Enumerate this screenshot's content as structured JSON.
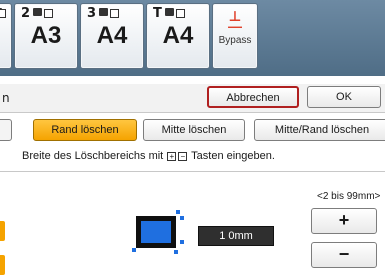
{
  "trays": [
    {
      "number": "",
      "size": "",
      "partial": true
    },
    {
      "number": "2",
      "size": "A3"
    },
    {
      "number": "3",
      "size": "A4"
    },
    {
      "number": "T",
      "size": "A4"
    }
  ],
  "bypass": {
    "icon": "bypass-tray-icon",
    "label": "Bypass"
  },
  "header": {
    "left_fragment": "n",
    "cancel_label": "Abbrechen",
    "ok_label": "OK"
  },
  "tabs": {
    "rand": "Rand löschen",
    "mitte": "Mitte löschen",
    "mitte_rand": "Mitte/Rand löschen",
    "selected": "rand"
  },
  "instruction": {
    "prefix": "Breite des Löschbereichs mit",
    "suffix": "Tasten eingeben.",
    "key_glyphs": [
      "⊞",
      "⊟"
    ]
  },
  "range": "<2 bis 99mm>",
  "value_display": "1 0mm",
  "stepper": {
    "plus": "+",
    "minus": "−"
  },
  "colors": {
    "accent": "#f5a300",
    "preview_blue": "#1f6fe0",
    "cancel_border": "#b02020"
  }
}
